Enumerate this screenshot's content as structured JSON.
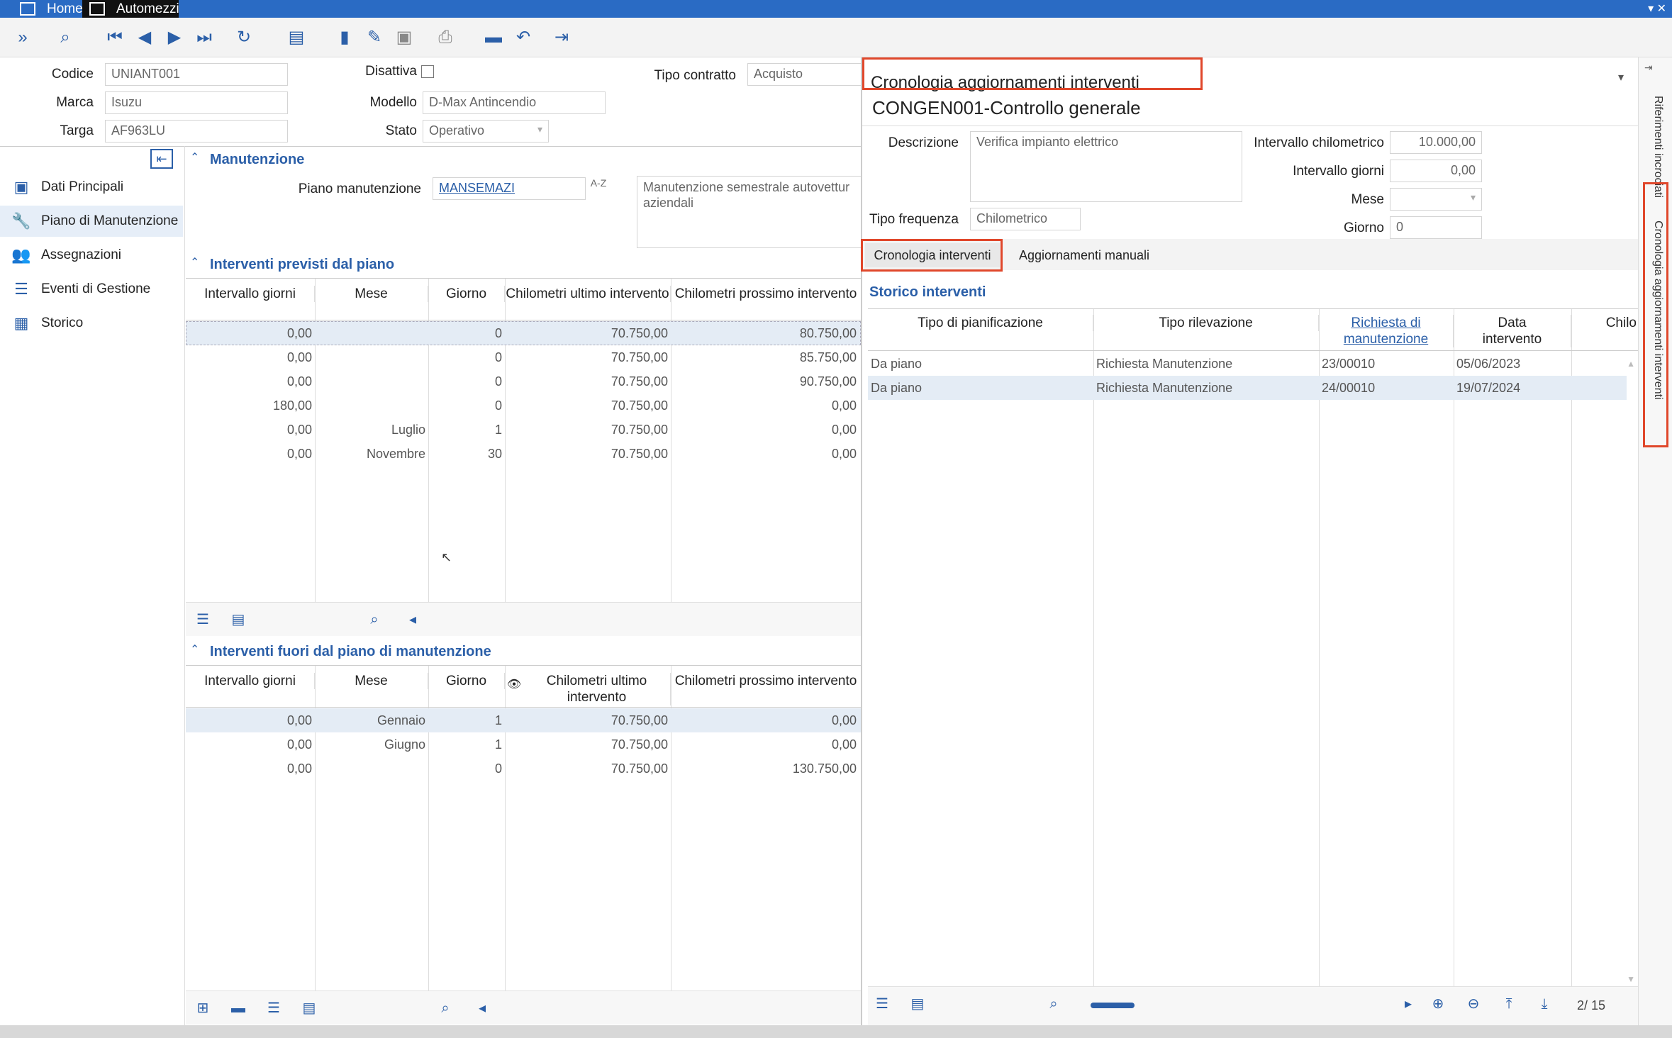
{
  "titlebar": {
    "tabs": [
      {
        "label": "Home"
      },
      {
        "label": "Automezzi"
      }
    ]
  },
  "toolbar": {
    "icons": [
      "expand-icon",
      "search-icon",
      "first-record-icon",
      "prev-record-icon",
      "next-record-icon",
      "last-record-icon",
      "refresh-icon",
      "export-icon",
      "new-icon",
      "edit-icon",
      "save-icon",
      "print-icon",
      "delete-icon",
      "undo-icon",
      "exit-icon"
    ]
  },
  "header": {
    "codice_label": "Codice",
    "codice": "UNIANT001",
    "marca_label": "Marca",
    "marca": "Isuzu",
    "targa_label": "Targa",
    "targa": "AF963LU",
    "disattiva_label": "Disattiva",
    "modello_label": "Modello",
    "modello": "D-Max Antincendio",
    "stato_label": "Stato",
    "stato": "Operativo",
    "tipo_contratto_label": "Tipo contratto",
    "tipo_contratto": "Acquisto"
  },
  "sidebar": {
    "items": [
      {
        "label": "Dati Principali",
        "icon": "id-card-icon"
      },
      {
        "label": "Piano di Manutenzione",
        "icon": "wrench-icon"
      },
      {
        "label": "Assegnazioni",
        "icon": "people-icon"
      },
      {
        "label": "Eventi di Gestione",
        "icon": "checklist-icon"
      },
      {
        "label": "Storico",
        "icon": "calendar-icon"
      }
    ]
  },
  "manutenzione": {
    "title": "Manutenzione",
    "piano_label": "Piano manutenzione",
    "piano_value": "MANSEMAZI",
    "descrizione": "Manutenzione semestrale autovettur aziendali"
  },
  "previsti": {
    "title": "Interventi previsti dal piano",
    "headers": [
      "Intervallo giorni",
      "Mese",
      "Giorno",
      "Chilometri ultimo intervento",
      "Chilometri prossimo intervento"
    ],
    "rows": [
      [
        "0,00",
        "",
        "0",
        "70.750,00",
        "80.750,00"
      ],
      [
        "0,00",
        "",
        "0",
        "70.750,00",
        "85.750,00"
      ],
      [
        "0,00",
        "",
        "0",
        "70.750,00",
        "90.750,00"
      ],
      [
        "180,00",
        "",
        "0",
        "70.750,00",
        "0,00"
      ],
      [
        "0,00",
        "Luglio",
        "1",
        "70.750,00",
        "0,00"
      ],
      [
        "0,00",
        "Novembre",
        "30",
        "70.750,00",
        "0,00"
      ]
    ]
  },
  "fuori": {
    "title": "Interventi fuori dal piano di manutenzione",
    "headers": [
      "Intervallo giorni",
      "Mese",
      "Giorno",
      "Chilometri ultimo intervento",
      "Chilometri prossimo intervento"
    ],
    "rows": [
      [
        "0,00",
        "Gennaio",
        "1",
        "70.750,00",
        "0,00"
      ],
      [
        "0,00",
        "Giugno",
        "1",
        "70.750,00",
        "0,00"
      ],
      [
        "0,00",
        "",
        "0",
        "70.750,00",
        "130.750,00"
      ]
    ]
  },
  "right": {
    "panel_title": "Cronologia aggiornamenti interventi",
    "heading": "CONGEN001-Controllo generale",
    "descrizione_label": "Descrizione",
    "descrizione": "Verifica impianto elettrico",
    "tipo_freq_label": "Tipo frequenza",
    "tipo_freq": "Chilometrico",
    "int_km_label": "Intervallo chilometrico",
    "int_km": "10.000,00",
    "int_gg_label": "Intervallo giorni",
    "int_gg": "0,00",
    "mese_label": "Mese",
    "mese": "",
    "giorno_label": "Giorno",
    "giorno": "0",
    "tabs": [
      {
        "label": "Cronologia interventi"
      },
      {
        "label": "Aggiornamenti manuali"
      }
    ],
    "storico_title": "Storico interventi",
    "headers": [
      "Tipo di pianificazione",
      "Tipo rilevazione",
      "Richiesta di manutenzione",
      "Data intervento",
      "Chilo"
    ],
    "rows": [
      [
        "Da piano",
        "Richiesta Manutenzione",
        "23/00010",
        "05/06/2023"
      ],
      [
        "Da piano",
        "Richiesta Manutenzione",
        "24/00010",
        "19/07/2024"
      ]
    ],
    "pager": "2/ 15"
  },
  "vertical_tabs": [
    "Riferimenti incrociati",
    "Cronologia aggiornamenti interventi"
  ],
  "colors": {
    "accent": "#2b5fa8",
    "highlight": "#e0472b",
    "selected_row": "#e4ecf5",
    "titlebar": "#2a6bc4"
  }
}
